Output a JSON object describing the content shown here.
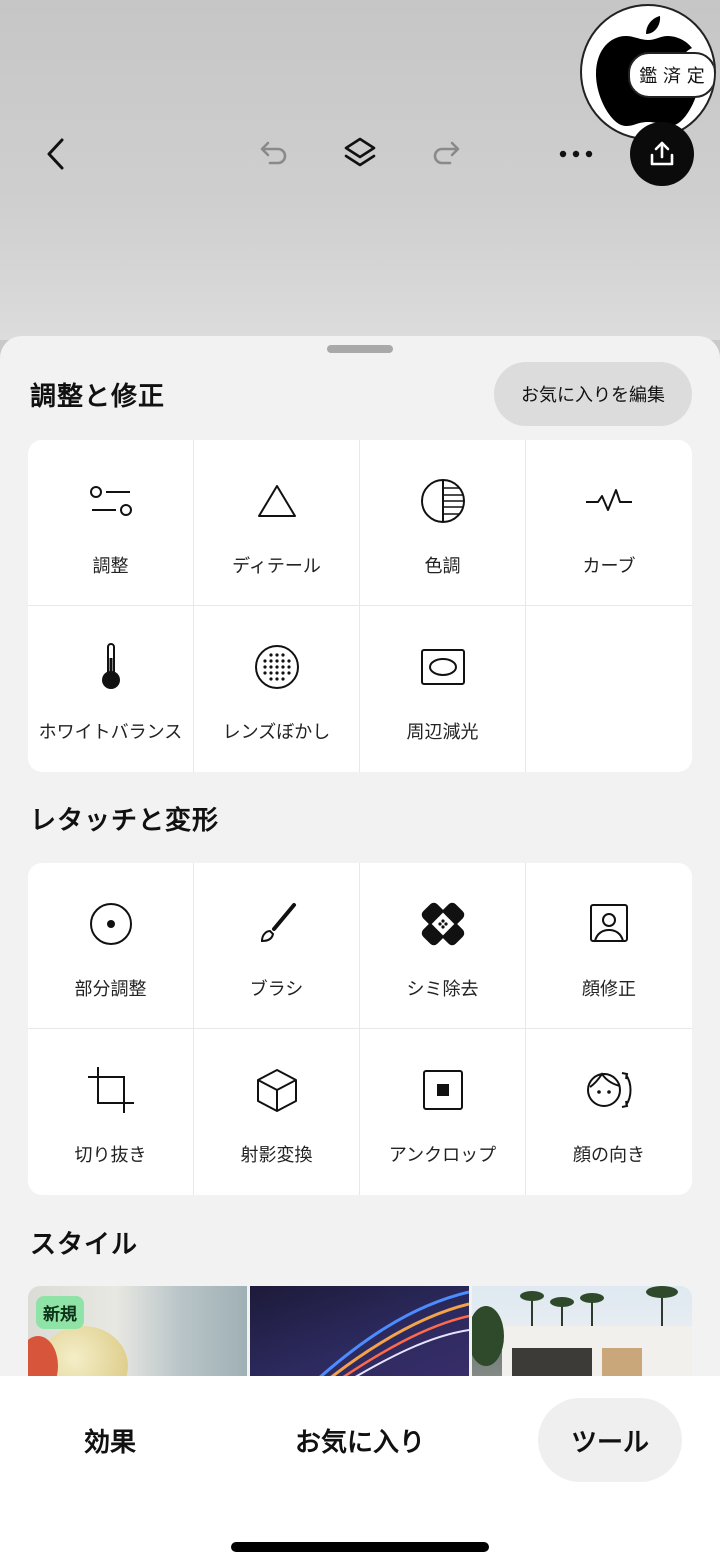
{
  "toolbar": {
    "back_icon": "chevron-left-icon",
    "undo_icon": "undo-icon",
    "layers_icon": "layers-icon",
    "redo_icon": "redo-icon",
    "more_icon": "more-icon",
    "share_icon": "share-icon"
  },
  "watermark": {
    "text": "鑑 済 定"
  },
  "sheet": {
    "adjust_section": {
      "title": "調整と修正",
      "edit_favorites_label": "お気に入りを編集",
      "tools": [
        {
          "label": "調整",
          "icon": "adjust-sliders-icon"
        },
        {
          "label": "ディテール",
          "icon": "triangle-icon"
        },
        {
          "label": "色調",
          "icon": "tone-icon"
        },
        {
          "label": "カーブ",
          "icon": "curve-icon"
        },
        {
          "label": "ホワイトバランス",
          "icon": "thermometer-icon"
        },
        {
          "label": "レンズぼかし",
          "icon": "lens-blur-icon"
        },
        {
          "label": "周辺減光",
          "icon": "vignette-icon"
        }
      ]
    },
    "retouch_section": {
      "title": "レタッチと変形",
      "tools": [
        {
          "label": "部分調整",
          "icon": "selective-adjust-icon"
        },
        {
          "label": "ブラシ",
          "icon": "brush-icon"
        },
        {
          "label": "シミ除去",
          "icon": "bandage-icon"
        },
        {
          "label": "顔修正",
          "icon": "face-portrait-icon"
        },
        {
          "label": "切り抜き",
          "icon": "crop-icon"
        },
        {
          "label": "射影変換",
          "icon": "perspective-cube-icon"
        },
        {
          "label": "アンクロップ",
          "icon": "uncrop-icon"
        },
        {
          "label": "顔の向き",
          "icon": "face-turn-icon"
        }
      ]
    },
    "style_section": {
      "title": "スタイル",
      "new_badge": "新規"
    }
  },
  "bottom_tabs": [
    {
      "label": "効果",
      "active": false
    },
    {
      "label": "お気に入り",
      "active": false
    },
    {
      "label": "ツール",
      "active": true
    }
  ]
}
